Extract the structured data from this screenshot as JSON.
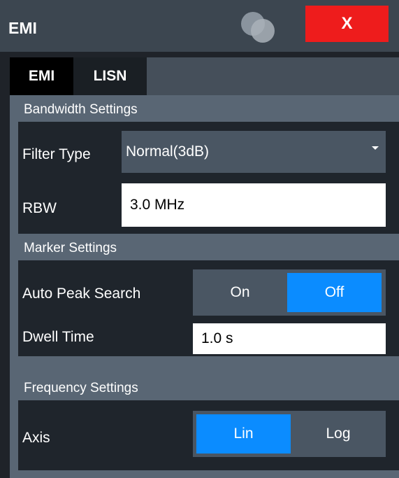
{
  "window": {
    "title": "EMI",
    "close_label": "X"
  },
  "tabs": [
    {
      "label": "EMI",
      "active": true
    },
    {
      "label": "LISN",
      "active": false
    }
  ],
  "bandwidth": {
    "section_label": "Bandwidth Settings",
    "filter_type_label": "Filter Type",
    "filter_type_value": "Normal(3dB)",
    "rbw_label": "RBW",
    "rbw_value": "3.0 MHz"
  },
  "marker": {
    "section_label": "Marker Settings",
    "auto_peak_label": "Auto Peak Search",
    "auto_peak_options": [
      "On",
      "Off"
    ],
    "auto_peak_selected": "Off",
    "dwell_label": "Dwell Time",
    "dwell_value": "1.0 s"
  },
  "frequency": {
    "section_label": "Frequency Settings",
    "axis_label": "Axis",
    "axis_options": [
      "Lin",
      "Log"
    ],
    "axis_selected": "Lin"
  },
  "colors": {
    "accent": "#0b8cff",
    "close": "#ee1c1c",
    "panel": "#596674",
    "group": "#1f252c"
  },
  "icons": {
    "logo": "overlapping-circles-logo",
    "filter_dropdown": "chevron-down-icon"
  }
}
